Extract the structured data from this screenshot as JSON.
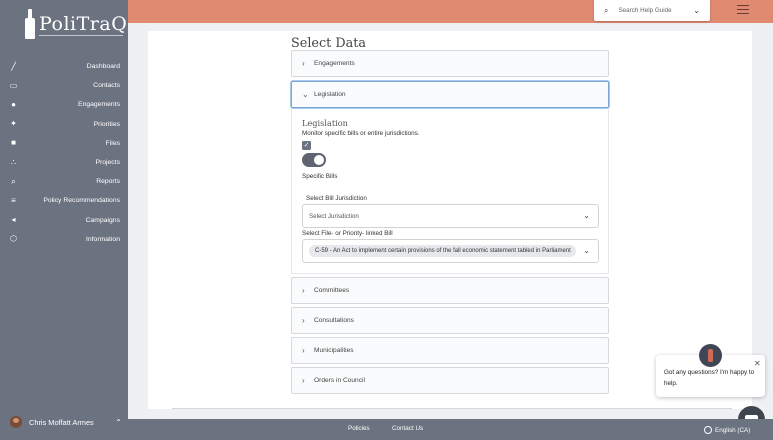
{
  "app": {
    "logo_text": "PoliTraQ"
  },
  "sidebar": {
    "items": [
      {
        "label": "Dashboard",
        "icon": "chart-line-icon"
      },
      {
        "label": "Contacts",
        "icon": "contact-card-icon"
      },
      {
        "label": "Engagements",
        "icon": "people-group-icon"
      },
      {
        "label": "Priorities",
        "icon": "target-icon"
      },
      {
        "label": "Files",
        "icon": "folder-icon"
      },
      {
        "label": "Projects",
        "icon": "hierarchy-icon"
      },
      {
        "label": "Reports",
        "icon": "magnifier-icon"
      },
      {
        "label": "Policy Recommendations",
        "icon": "list-icon"
      },
      {
        "label": "Campaigns",
        "icon": "megaphone-icon"
      },
      {
        "label": "Information",
        "icon": "box-icon"
      }
    ],
    "user": {
      "name": "Chris Moffatt Armes"
    }
  },
  "topbar": {
    "search_label": "Search Help Guide"
  },
  "main": {
    "title": "Select Data",
    "sections": {
      "engagements": "Engagements",
      "legislation": "Legislation",
      "committees": "Committees",
      "consultations": "Consultations",
      "municipalities": "Municipalities",
      "orders_in_council": "Orders in Council"
    },
    "legislation": {
      "heading": "Legislation",
      "description": "Monitor specific bills or entire jurisdictions.",
      "toggle_label": "Specific Bills",
      "checkbox_checked": true,
      "toggle_on": true,
      "jurisdiction_label": "Select Bill Jurisdiction",
      "jurisdiction_value": "Select Jurisdiction",
      "bill_label": "Select File- or Priority- linked Bill",
      "bill_value": "C-59 - An Act to implement certain provisions of the fall economic statement tabled in Parliament"
    }
  },
  "chat": {
    "message": "Got any questions? I'm happy to help."
  },
  "footer": {
    "policies": "Policies",
    "contact": "Contact Us",
    "language": "English (CA)"
  },
  "colors": {
    "sidebar": "#6b7280",
    "topbar": "#e08a72",
    "accent_border": "#7aa7d8"
  }
}
